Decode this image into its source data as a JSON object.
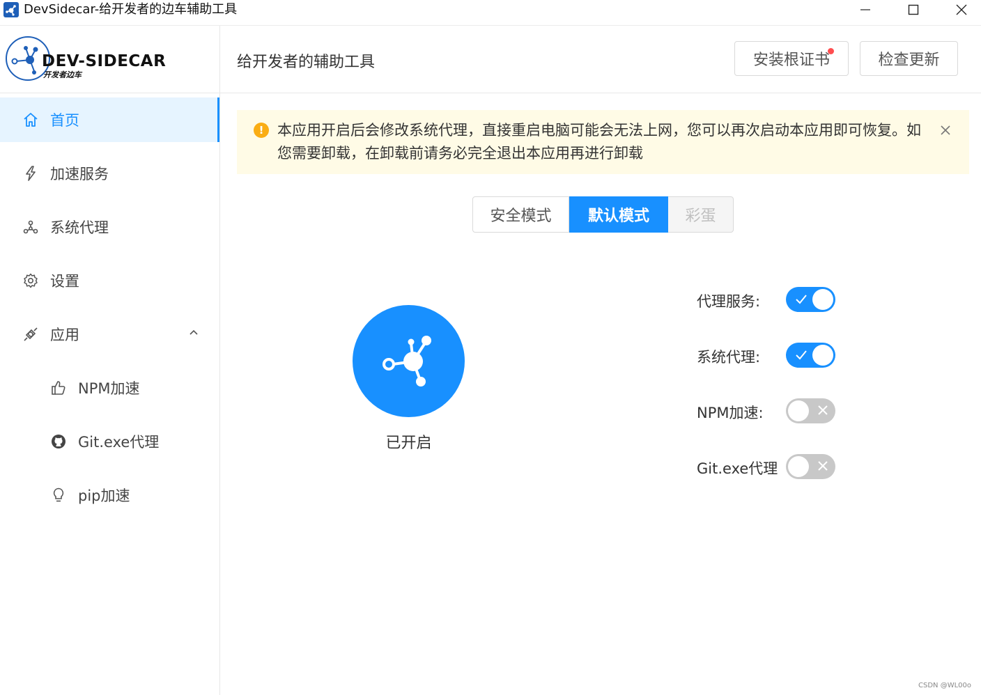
{
  "window": {
    "title": "DevSidecar-给开发者的边车辅助工具",
    "controls": [
      "minimize",
      "maximize",
      "close"
    ]
  },
  "sidebar": {
    "logo": {
      "text": "DEV-SIDECAR",
      "subtext": "开发者边车"
    },
    "items": [
      {
        "label": "首页",
        "icon": "home-icon",
        "active": true
      },
      {
        "label": "加速服务",
        "icon": "lightning-icon"
      },
      {
        "label": "系统代理",
        "icon": "network-icon"
      },
      {
        "label": "设置",
        "icon": "gear-icon"
      },
      {
        "label": "应用",
        "icon": "api-icon",
        "expanded": true
      },
      {
        "label": "NPM加速",
        "icon": "thumbs-up-icon"
      },
      {
        "label": "Git.exe代理",
        "icon": "github-icon"
      },
      {
        "label": "pip加速",
        "icon": "bulb-icon"
      }
    ]
  },
  "header": {
    "title": "给开发者的辅助工具",
    "install_cert_label": "安装根证书",
    "check_update_label": "检查更新"
  },
  "alert": {
    "text": "本应用开启后会修改系统代理，直接重启电脑可能会无法上网，您可以再次启动本应用即可恢复。如您需要卸载，在卸载前请务必完全退出本应用再进行卸载"
  },
  "modes": {
    "items": [
      "安全模式",
      "默认模式",
      "彩蛋"
    ],
    "selected": "默认模式"
  },
  "status": {
    "label": "已开启"
  },
  "switches": [
    {
      "label": "代理服务:",
      "on": true
    },
    {
      "label": "系统代理:",
      "on": true
    },
    {
      "label": "NPM加速:",
      "on": false
    },
    {
      "label": "Git.exe代理",
      "on": false
    }
  ],
  "colors": {
    "primary": "#1890ff",
    "alert_bg": "#fffbe6",
    "warning": "#faad14",
    "switch_off": "#c8c8c8"
  },
  "watermark": "CSDN @WL00o"
}
